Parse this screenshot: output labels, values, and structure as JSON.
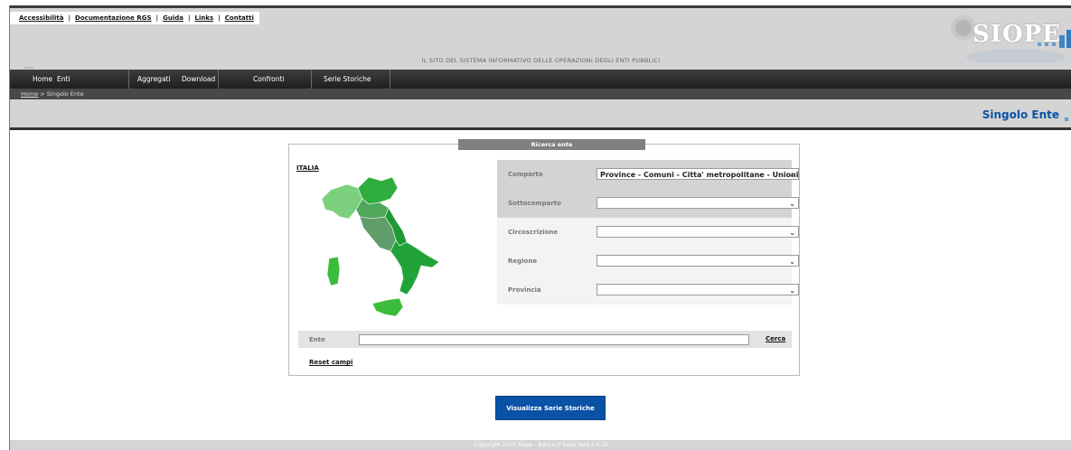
{
  "top_links": [
    {
      "label": "Accessibilità"
    },
    {
      "label": "Documentazione RGS"
    },
    {
      "label": "Guida"
    },
    {
      "label": "Links"
    },
    {
      "label": "Contatti"
    }
  ],
  "header": {
    "tagline": "IL SITO DEL SISTEMA INFORMATIVO DELLE OPERAZIONI DEGLI ENTI PUBBLICI",
    "logo_text": "SIOPE"
  },
  "nav": [
    {
      "label": "Home"
    },
    {
      "label": "Enti"
    },
    {
      "label": "Aggregati"
    },
    {
      "label": "Download"
    },
    {
      "label": "Confronti"
    },
    {
      "label": "Serie Storiche"
    }
  ],
  "breadcrumb": {
    "home": "Home",
    "sep": " > ",
    "current": "Singolo Ente"
  },
  "page_title": "Singolo Ente",
  "search": {
    "panel_title": "Ricerca ente",
    "map_link": "ITALIA",
    "fields": [
      {
        "label": "Comparto",
        "value": "Province - Comuni - Citta' metropolitane - Unioni"
      },
      {
        "label": "Sottocomparto",
        "value": ""
      },
      {
        "label": "Circoscrizione",
        "value": ""
      },
      {
        "label": "Regione",
        "value": ""
      },
      {
        "label": "Provincia",
        "value": ""
      }
    ],
    "ente_label": "Ente",
    "ente_value": "",
    "cerca_label": "Cerca",
    "reset_label": "Reset campi"
  },
  "visualizza_button": "Visualizza Serie Storiche",
  "footer": "Copyright 2015 Siope - Banca D'Italia   Vers.3.0.15",
  "colors": {
    "accent_blue": "#0a52a6",
    "north": "#7ccf7c",
    "north_east": "#2fae3f",
    "center": "#5f9e6a",
    "south": "#22a33a",
    "islands": "#3cbc3c"
  }
}
